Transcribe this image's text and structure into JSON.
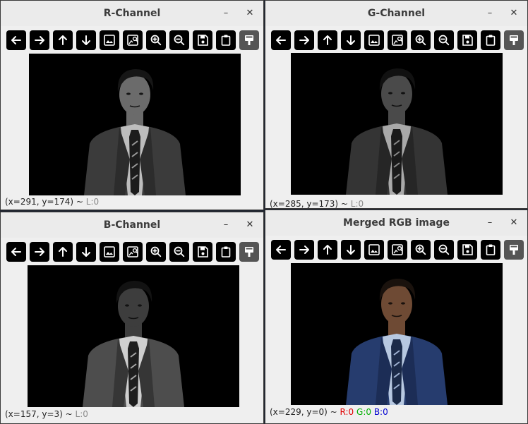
{
  "windows": [
    {
      "id": "r",
      "title": "R-Channel",
      "minimize": "–",
      "close": "✕",
      "status_coords": "(x=291, y=174) ~ ",
      "status_value": "L:0"
    },
    {
      "id": "g",
      "title": "G-Channel",
      "minimize": "–",
      "close": "✕",
      "status_coords": "(x=285, y=173) ~ ",
      "status_value": "L:0"
    },
    {
      "id": "b",
      "title": "B-Channel",
      "minimize": "–",
      "close": "✕",
      "status_coords": "(x=157, y=3) ~ ",
      "status_value": "L:0"
    },
    {
      "id": "rgb",
      "title": "Merged RGB image",
      "minimize": "–",
      "close": "✕",
      "status_coords": "(x=229, y=0) ~ ",
      "status_r": "R:0",
      "status_g": "G:0",
      "status_b": "B:0"
    }
  ],
  "toolbar_icons": [
    "arrow-left-icon",
    "arrow-right-icon",
    "arrow-up-icon",
    "arrow-down-icon",
    "image-icon",
    "image-search-icon",
    "zoom-in-icon",
    "zoom-out-icon",
    "save-icon",
    "clipboard-icon",
    "paint-brush-icon"
  ],
  "colors": {
    "toolbar_button": "#000000",
    "toolbar_button_last": "#555555",
    "status_r": "#e00000",
    "status_g": "#00b000",
    "status_b": "#0000d0"
  }
}
